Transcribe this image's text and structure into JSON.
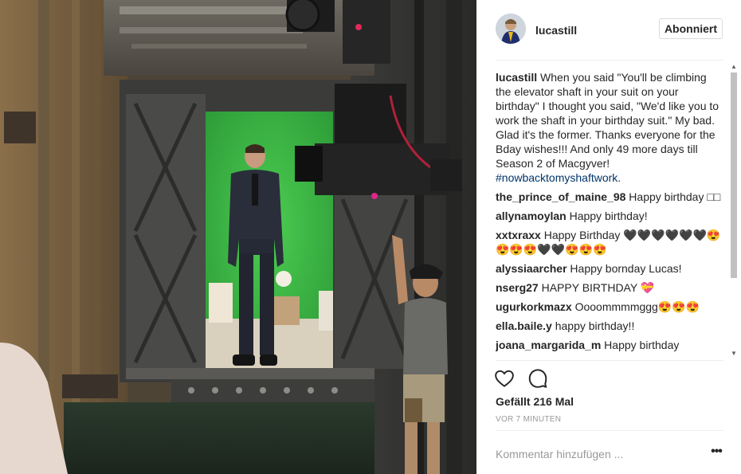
{
  "post": {
    "username": "lucastill",
    "follow_label": "Abonniert",
    "caption": {
      "user": "lucastill",
      "text_1": " When you said \"You'll be climbing the elevator shaft in your suit on your birthday\" I thought you said, \"We'd like you to work the shaft in your birthday suit.\" My bad. Glad it's the former. Thanks everyone for the Bday wishes!!! And only 49 more days till Season 2 of Macgyver! ",
      "hashtag": "#nowbacktomyshaftwork",
      "text_2": "."
    },
    "comments": [
      {
        "user": "the_prince_of_maine_98",
        "text": " Happy birthday □□"
      },
      {
        "user": "allynamoylan",
        "text": " Happy birthday!"
      },
      {
        "user": "xxtxraxx",
        "text": " Happy Birthday 🖤🖤🖤🖤🖤🖤😍😍😍😍🖤🖤😍😍😍"
      },
      {
        "user": "alyssiaarcher",
        "text": " Happy bornday Lucas!"
      },
      {
        "user": "nserg27",
        "text": " HAPPY BIRTHDAY 💝"
      },
      {
        "user": "ugurkorkmazx",
        "text": " Oooommmmggg😍😍😍"
      },
      {
        "user": "ella.baile.y",
        "text": " happy birthday!!"
      },
      {
        "user": "joana_margarida_m",
        "text": " Happy birthday"
      }
    ],
    "likes_label": "Gefällt 216 Mal",
    "time_label": "VOR 7 MINUTEN",
    "comment_placeholder": "Kommentar hinzufügen ...",
    "more_label": "•••"
  },
  "icons": {
    "like": "heart-icon",
    "comment": "speech-bubble-icon",
    "more": "more-options-icon",
    "scroll_up": "triangle-up",
    "scroll_down": "triangle-down"
  },
  "colors": {
    "text": "#262626",
    "secondary_text": "#999999",
    "hashtag": "#003569",
    "divider": "#efefef",
    "green_screen": "#39b54a"
  }
}
